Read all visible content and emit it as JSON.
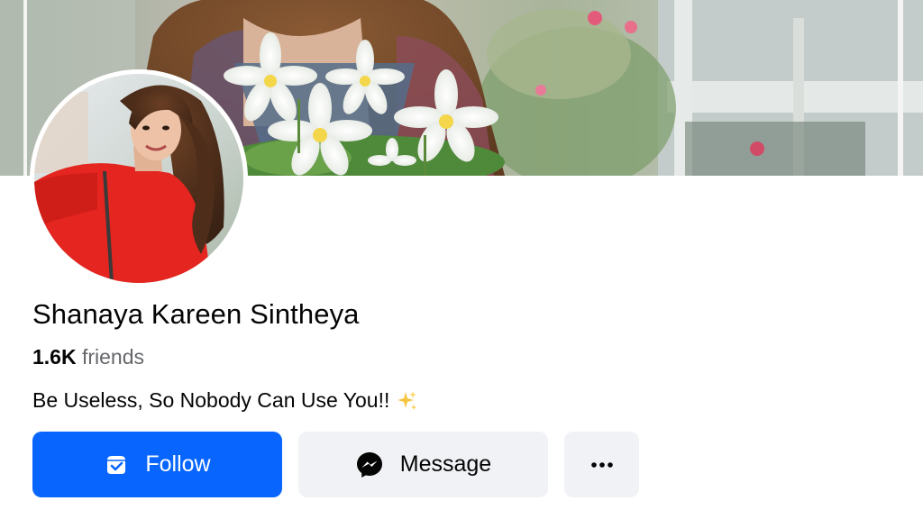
{
  "profile": {
    "name": "Shanaya Kareen Sintheya",
    "friends_count": "1.6K",
    "friends_label": "friends",
    "bio": "Be Useless, So Nobody Can Use You!!"
  },
  "actions": {
    "follow_label": "Follow",
    "message_label": "Message",
    "more_label": "•••"
  },
  "icons": {
    "follow": "follow-check-icon",
    "message": "messenger-icon",
    "more": "more-dots-icon",
    "bio_emoji": "sparkles-icon"
  },
  "colors": {
    "primary": "#0866ff",
    "secondary_button": "#f0f2f5",
    "muted_text": "#65676b"
  }
}
